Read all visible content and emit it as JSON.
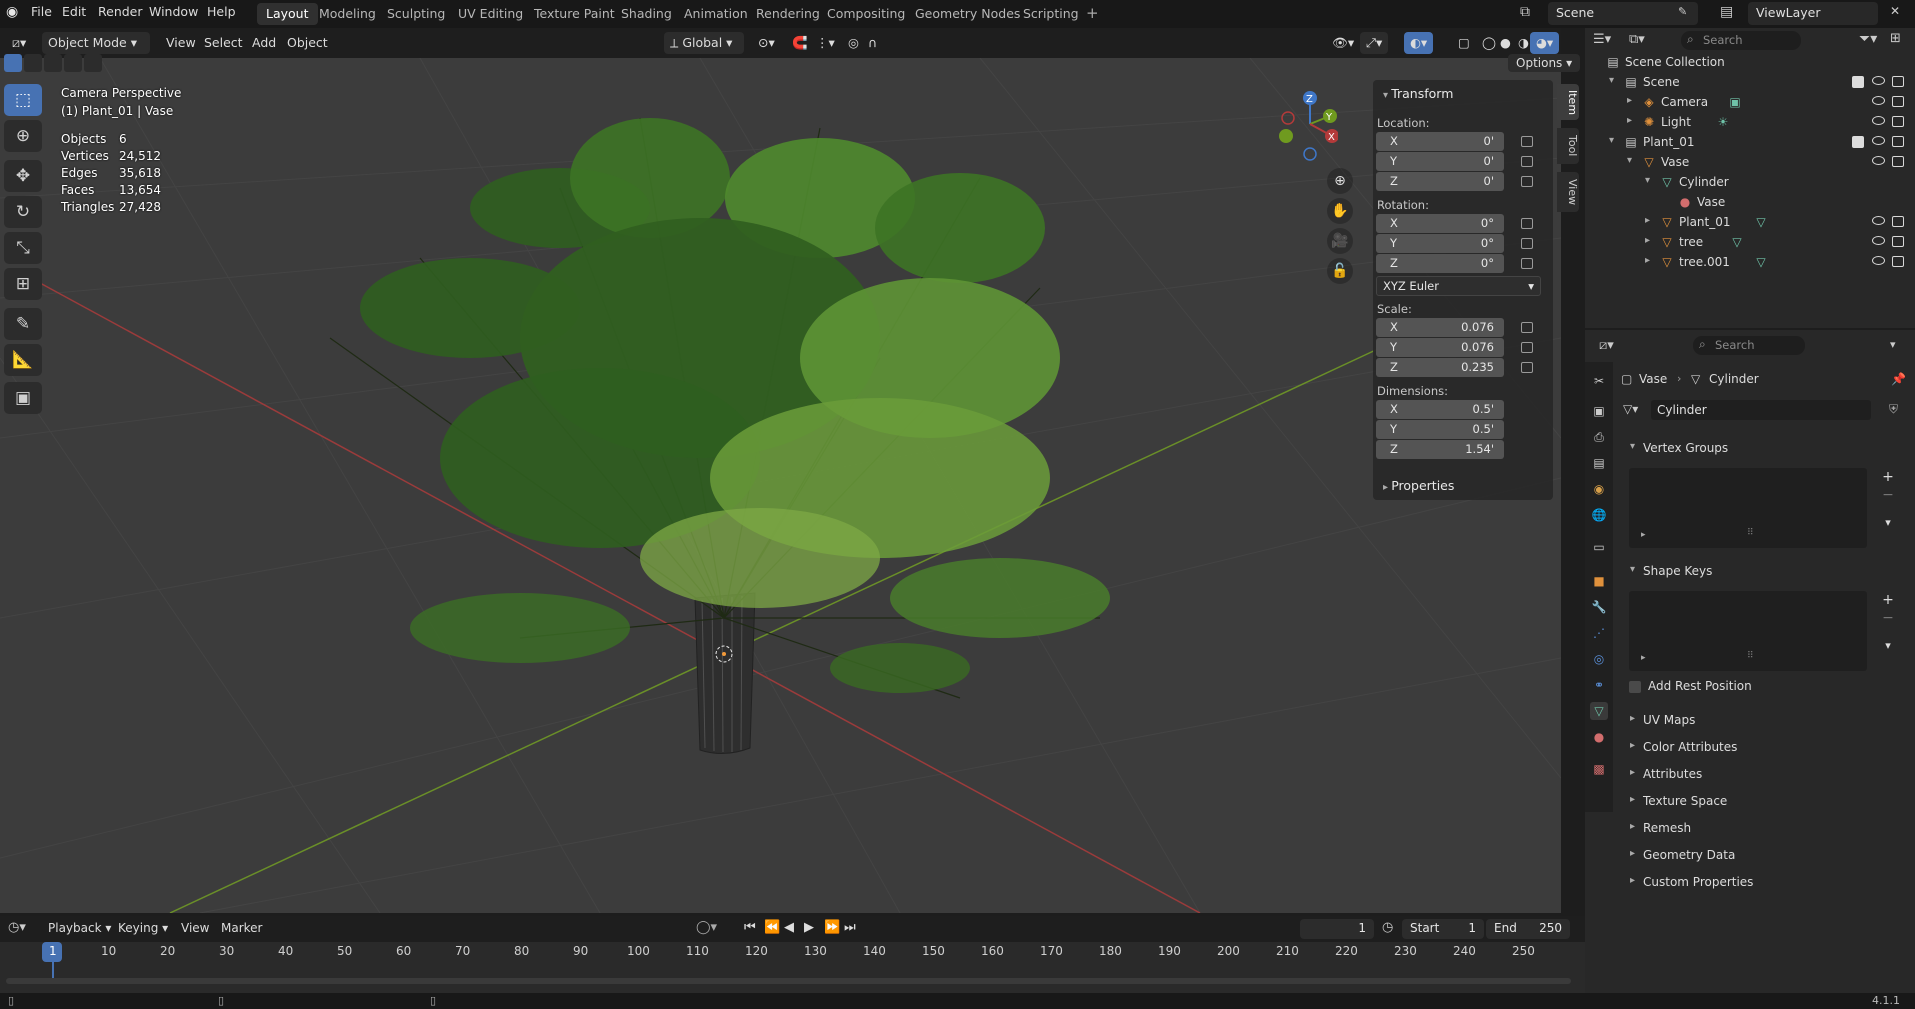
{
  "menu": {
    "file": "File",
    "edit": "Edit",
    "render": "Render",
    "window": "Window",
    "help": "Help"
  },
  "workspaces": [
    "Layout",
    "Modeling",
    "Sculpting",
    "UV Editing",
    "Texture Paint",
    "Shading",
    "Animation",
    "Rendering",
    "Compositing",
    "Geometry Nodes",
    "Scripting"
  ],
  "active_workspace": "Layout",
  "scene": {
    "name": "Scene",
    "view_layer": "ViewLayer"
  },
  "viewport_header": {
    "mode": "Object Mode",
    "view": "View",
    "select": "Select",
    "add": "Add",
    "object": "Object",
    "orientation": "Global",
    "options": "Options"
  },
  "overlay_info": {
    "perspective": "Camera Perspective",
    "active": "(1) Plant_01 | Vase"
  },
  "stats": [
    {
      "label": "Objects",
      "value": "6"
    },
    {
      "label": "Vertices",
      "value": "24,512"
    },
    {
      "label": "Edges",
      "value": "35,618"
    },
    {
      "label": "Faces",
      "value": "13,654"
    },
    {
      "label": "Triangles",
      "value": "27,428"
    }
  ],
  "transform": {
    "title": "Transform",
    "location_label": "Location:",
    "location": {
      "x": "0'",
      "y": "0'",
      "z": "0'"
    },
    "rotation_label": "Rotation:",
    "rotation": {
      "x": "0°",
      "y": "0°",
      "z": "0°"
    },
    "rotation_mode": "XYZ Euler",
    "scale_label": "Scale:",
    "scale": {
      "x": "0.076",
      "y": "0.076",
      "z": "0.235"
    },
    "dimensions_label": "Dimensions:",
    "dimensions": {
      "x": "0.5'",
      "y": "0.5'",
      "z": "1.54'"
    },
    "properties": "Properties"
  },
  "axes": {
    "x": "X",
    "y": "Y",
    "z": "Z"
  },
  "sidebar_tabs": [
    "Item",
    "Tool",
    "View"
  ],
  "outliner": {
    "search_placeholder": "Search",
    "rows": [
      {
        "label": "Scene Collection",
        "indent": 0
      },
      {
        "label": "Scene",
        "indent": 1
      },
      {
        "label": "Camera",
        "indent": 2
      },
      {
        "label": "Light",
        "indent": 2
      },
      {
        "label": "Plant_01",
        "indent": 1
      },
      {
        "label": "Vase",
        "indent": 2
      },
      {
        "label": "Cylinder",
        "indent": 3
      },
      {
        "label": "Vase",
        "indent": 4
      },
      {
        "label": "Plant_01",
        "indent": 3
      },
      {
        "label": "tree",
        "indent": 3
      },
      {
        "label": "tree.001",
        "indent": 3
      }
    ]
  },
  "properties": {
    "search_placeholder": "Search",
    "breadcrumb": {
      "object": "Vase",
      "data": "Cylinder"
    },
    "mesh_name": "Cylinder",
    "vertex_groups": "Vertex Groups",
    "shape_keys": "Shape Keys",
    "add_rest_position": "Add Rest Position",
    "sections": [
      "UV Maps",
      "Color Attributes",
      "Attributes",
      "Texture Space",
      "Remesh",
      "Geometry Data",
      "Custom Properties"
    ]
  },
  "timeline": {
    "playback": "Playback",
    "keying": "Keying",
    "view": "View",
    "marker": "Marker",
    "current_frame": "1",
    "start_label": "Start",
    "start": "1",
    "end_label": "End",
    "end": "250",
    "ticks": [
      "1",
      "10",
      "20",
      "30",
      "40",
      "50",
      "60",
      "70",
      "80",
      "90",
      "100",
      "110",
      "120",
      "130",
      "140",
      "150",
      "160",
      "170",
      "180",
      "190",
      "200",
      "210",
      "220",
      "230",
      "240",
      "250"
    ]
  },
  "version": "4.1.1",
  "colors": {
    "accent": "#4772b3",
    "leaf_dark": "#2f5e1f",
    "leaf_light": "#7da845",
    "x_axis": "#b33a3a",
    "y_axis": "#6f9a1f",
    "z_axis": "#3f77c8"
  }
}
